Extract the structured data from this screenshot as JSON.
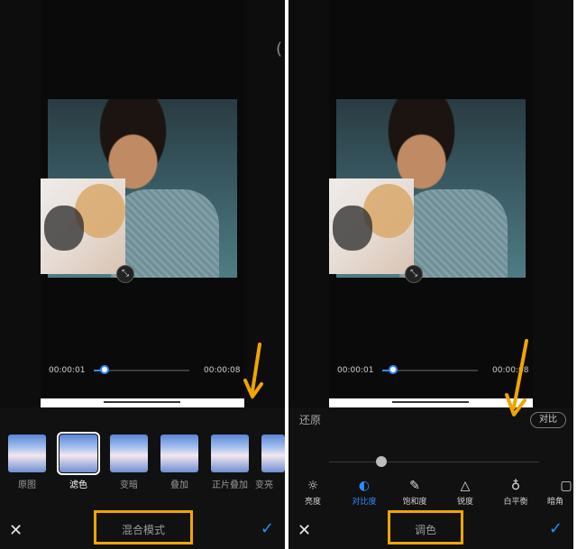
{
  "colors": {
    "accent": "#2f8cff",
    "highlight_box": "#f0a500",
    "arrow": "#f0a500"
  },
  "left": {
    "time_start": "00:00:01",
    "time_end": "00:00:08",
    "progress": 0.12,
    "thumbnails": [
      {
        "label": "原图",
        "selected": false
      },
      {
        "label": "滤色",
        "selected": true
      },
      {
        "label": "变暗",
        "selected": false
      },
      {
        "label": "叠加",
        "selected": false
      },
      {
        "label": "正片叠加",
        "selected": false
      },
      {
        "label": "变亮",
        "selected": false
      }
    ],
    "tab_title": "混合模式",
    "close_icon": "close-icon",
    "confirm_icon": "check-icon"
  },
  "right": {
    "time_start": "00:00:01",
    "time_end": "00:00:08",
    "progress": 0.12,
    "restore_label": "还原",
    "current_adjust_label": "对比",
    "tools": [
      {
        "icon": "sun-icon",
        "label": "亮度",
        "active": false
      },
      {
        "icon": "contrast-icon",
        "label": "对比度",
        "active": true
      },
      {
        "icon": "dropper-icon",
        "label": "饱和度",
        "active": false
      },
      {
        "icon": "triangle-icon",
        "label": "锐度",
        "active": false
      },
      {
        "icon": "thermometer-icon",
        "label": "白平衡",
        "active": false
      },
      {
        "icon": "vignette-icon",
        "label": "暗角",
        "active": false
      }
    ],
    "tab_title": "调色",
    "close_icon": "close-icon",
    "confirm_icon": "check-icon"
  }
}
